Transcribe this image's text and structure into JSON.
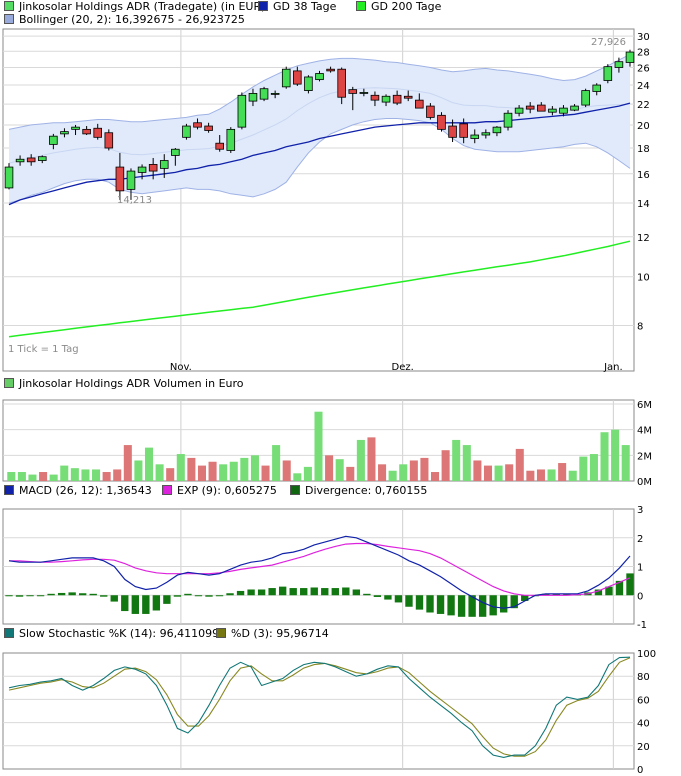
{
  "legend_main": [
    {
      "text": "Jinkosolar Holdings ADR (Tradegate) (in EUR)",
      "color": "#55dd66"
    },
    {
      "text": "GD 38 Tage",
      "color": "#1122aa"
    },
    {
      "text": "GD 200 Tage",
      "color": "#22ee22"
    },
    {
      "text": "Bollinger (20, 2): 16,392675 - 26,923725",
      "color": "#99aadd"
    }
  ],
  "legend_volume": {
    "text": "Jinkosolar Holdings ADR Volumen in Euro",
    "color": "#66cc66"
  },
  "legend_macd": [
    {
      "text": "MACD (26, 12): 1,36543",
      "color": "#1122aa"
    },
    {
      "text": "EXP (9): 0,605275",
      "color": "#dd22dd"
    },
    {
      "text": "Divergence: 0,760155",
      "color": "#116611"
    }
  ],
  "legend_stoch": [
    {
      "text": "Slow Stochastic %K (14): 96,411099",
      "color": "#117777"
    },
    {
      "text": "%D (3): 95,96714",
      "color": "#777711"
    }
  ],
  "tick_note": "1 Tick = 1 Tag",
  "annotations": {
    "low": "14,213",
    "high": "27,926"
  },
  "colors": {
    "up": "#44dd55",
    "down": "#dd4444",
    "boll_fill": "#e0eafa",
    "boll_line": "#9fb2e6",
    "gd38": "#1122aa",
    "gd200": "#22ee22",
    "macd": "#1122aa",
    "signal": "#dd22dd",
    "hist": "#117711",
    "stoch_k": "#117777",
    "stoch_d": "#888822",
    "vol_up": "#77dd77",
    "vol_down": "#dd7777"
  },
  "chart_data": [
    {
      "type": "candlestick",
      "title": "Jinkosolar Holdings ADR (Tradegate) (in EUR)",
      "y_scale": "log",
      "ylim": [
        6.5,
        31
      ],
      "y_ticks": [
        8,
        10,
        12,
        14,
        16,
        18,
        20,
        22,
        24,
        26,
        28,
        30
      ],
      "x_tick_labels": [
        {
          "label": "Nov.",
          "index": 16
        },
        {
          "label": "Dez.",
          "index": 36
        },
        {
          "label": "Jan.",
          "index": 55
        }
      ],
      "ohlc": [
        [
          15.0,
          16.8,
          14.9,
          16.5
        ],
        [
          16.9,
          17.4,
          16.6,
          17.1
        ],
        [
          17.2,
          17.5,
          16.6,
          16.9
        ],
        [
          17.0,
          17.4,
          16.8,
          17.3
        ],
        [
          18.3,
          19.2,
          17.9,
          19.0
        ],
        [
          19.2,
          19.7,
          18.9,
          19.4
        ],
        [
          19.6,
          20.0,
          19.1,
          19.8
        ],
        [
          19.6,
          19.9,
          19.1,
          19.2
        ],
        [
          19.7,
          20.1,
          18.7,
          18.9
        ],
        [
          19.3,
          19.6,
          17.8,
          18.0
        ],
        [
          16.5,
          17.6,
          14.2,
          14.8
        ],
        [
          14.9,
          16.4,
          14.2,
          16.2
        ],
        [
          16.1,
          16.7,
          15.6,
          16.5
        ],
        [
          16.7,
          17.2,
          15.6,
          16.2
        ],
        [
          16.4,
          17.5,
          15.7,
          17.0
        ],
        [
          17.4,
          18.0,
          16.6,
          17.9
        ],
        [
          18.9,
          20.1,
          18.7,
          19.9
        ],
        [
          20.2,
          20.6,
          19.6,
          19.8
        ],
        [
          19.9,
          20.2,
          19.3,
          19.5
        ],
        [
          18.4,
          19.1,
          17.7,
          17.9
        ],
        [
          17.8,
          19.8,
          17.6,
          19.6
        ],
        [
          19.8,
          23.2,
          19.6,
          22.9
        ],
        [
          22.3,
          23.6,
          21.8,
          23.1
        ],
        [
          22.5,
          23.8,
          22.3,
          23.6
        ],
        [
          23.1,
          23.4,
          22.6,
          23.1
        ],
        [
          23.8,
          26.1,
          23.6,
          25.8
        ],
        [
          25.6,
          26.1,
          23.9,
          24.1
        ],
        [
          23.4,
          25.1,
          23.1,
          24.9
        ],
        [
          24.6,
          25.6,
          24.4,
          25.3
        ],
        [
          25.8,
          26.1,
          25.4,
          25.6
        ],
        [
          25.8,
          26.0,
          22.0,
          22.7
        ],
        [
          23.5,
          23.8,
          21.4,
          23.1
        ],
        [
          23.2,
          23.6,
          22.8,
          23.2
        ],
        [
          22.9,
          23.3,
          21.8,
          22.4
        ],
        [
          22.2,
          23.0,
          21.8,
          22.8
        ],
        [
          22.9,
          23.4,
          21.9,
          22.1
        ],
        [
          22.8,
          23.4,
          22.3,
          22.6
        ],
        [
          22.4,
          23.1,
          22.0,
          21.6
        ],
        [
          21.8,
          22.1,
          20.5,
          20.7
        ],
        [
          20.9,
          21.2,
          19.4,
          19.6
        ],
        [
          19.9,
          20.5,
          18.5,
          18.9
        ],
        [
          20.1,
          20.6,
          18.4,
          18.9
        ],
        [
          18.8,
          19.6,
          18.4,
          19.1
        ],
        [
          19.1,
          19.6,
          18.8,
          19.3
        ],
        [
          19.3,
          19.9,
          19.0,
          19.8
        ],
        [
          19.8,
          21.4,
          19.5,
          21.1
        ],
        [
          21.1,
          21.9,
          20.8,
          21.6
        ],
        [
          21.8,
          22.2,
          21.1,
          21.5
        ],
        [
          21.9,
          22.2,
          21.3,
          21.3
        ],
        [
          21.2,
          21.8,
          20.9,
          21.5
        ],
        [
          21.1,
          21.9,
          20.8,
          21.6
        ],
        [
          21.4,
          22.0,
          21.3,
          21.8
        ],
        [
          21.9,
          23.6,
          21.7,
          23.4
        ],
        [
          23.3,
          24.2,
          22.9,
          24.0
        ],
        [
          24.5,
          26.4,
          24.2,
          26.1
        ],
        [
          26.0,
          27.2,
          25.4,
          26.7
        ],
        [
          26.6,
          28.2,
          26.1,
          27.9
        ]
      ],
      "gd38": [
        13.9,
        14.2,
        14.4,
        14.6,
        14.8,
        15.0,
        15.2,
        15.4,
        15.5,
        15.6,
        15.6,
        15.7,
        15.8,
        15.9,
        16.0,
        16.1,
        16.3,
        16.4,
        16.6,
        16.7,
        16.9,
        17.1,
        17.4,
        17.6,
        17.8,
        18.1,
        18.3,
        18.5,
        18.8,
        19.0,
        19.2,
        19.4,
        19.6,
        19.8,
        19.9,
        20.0,
        20.1,
        20.2,
        20.2,
        20.2,
        20.2,
        20.2,
        20.2,
        20.3,
        20.3,
        20.4,
        20.5,
        20.6,
        20.7,
        20.8,
        20.9,
        21.0,
        21.2,
        21.4,
        21.6,
        21.8,
        22.1
      ],
      "gd200": [
        7.6,
        7.65,
        7.7,
        7.75,
        7.8,
        7.85,
        7.9,
        7.95,
        8.0,
        8.05,
        8.1,
        8.15,
        8.2,
        8.25,
        8.3,
        8.35,
        8.4,
        8.45,
        8.5,
        8.55,
        8.6,
        8.65,
        8.7,
        8.78,
        8.86,
        8.94,
        9.02,
        9.1,
        9.18,
        9.26,
        9.34,
        9.42,
        9.5,
        9.58,
        9.66,
        9.74,
        9.82,
        9.9,
        9.98,
        10.06,
        10.14,
        10.22,
        10.3,
        10.38,
        10.46,
        10.54,
        10.62,
        10.7,
        10.8,
        10.9,
        11.0,
        11.12,
        11.24,
        11.36,
        11.48,
        11.62,
        11.76
      ],
      "boll_upper": [
        19.6,
        19.8,
        20.0,
        20.1,
        20.2,
        20.2,
        20.3,
        20.4,
        20.5,
        20.5,
        20.4,
        20.3,
        20.3,
        20.4,
        20.5,
        20.6,
        20.7,
        20.9,
        21.0,
        21.5,
        22.2,
        23.0,
        23.8,
        24.5,
        25.1,
        25.7,
        26.2,
        26.5,
        26.8,
        27.0,
        27.1,
        27.1,
        27.0,
        26.9,
        26.7,
        26.6,
        26.4,
        26.2,
        26.0,
        25.7,
        25.5,
        25.6,
        25.8,
        25.9,
        25.7,
        25.6,
        25.4,
        25.2,
        25.0,
        24.7,
        24.5,
        24.6,
        25.0,
        25.6,
        26.2,
        26.9,
        27.6
      ],
      "boll_lower": [
        14.0,
        14.2,
        14.5,
        14.7,
        15.0,
        15.3,
        15.5,
        15.6,
        15.6,
        15.4,
        14.9,
        14.7,
        14.6,
        14.7,
        14.8,
        14.9,
        15.0,
        14.9,
        14.9,
        14.8,
        14.6,
        14.5,
        14.4,
        14.6,
        14.9,
        15.4,
        16.5,
        17.6,
        18.5,
        19.2,
        19.6,
        20.0,
        20.3,
        20.5,
        20.6,
        20.6,
        20.5,
        20.4,
        20.2,
        19.6,
        18.8,
        18.2,
        17.9,
        17.8,
        17.7,
        17.7,
        17.7,
        17.8,
        17.9,
        18.0,
        18.1,
        18.3,
        18.4,
        18.1,
        17.6,
        17.0,
        16.4
      ],
      "boll_mid": [
        16.8,
        17.0,
        17.2,
        17.4,
        17.6,
        17.75,
        17.9,
        18.0,
        18.05,
        17.95,
        17.65,
        17.5,
        17.45,
        17.55,
        17.65,
        17.75,
        17.85,
        17.9,
        17.95,
        18.15,
        18.4,
        18.75,
        19.1,
        19.55,
        20.0,
        20.55,
        21.35,
        22.05,
        22.65,
        23.1,
        23.35,
        23.55,
        23.65,
        23.7,
        23.65,
        23.6,
        23.45,
        23.3,
        23.1,
        22.65,
        22.15,
        21.9,
        21.85,
        21.85,
        21.7,
        21.65,
        21.55,
        21.5,
        21.45,
        21.35,
        21.3,
        21.45,
        21.7,
        21.85,
        21.9,
        21.95,
        22.0
      ]
    },
    {
      "type": "bar",
      "title": "Jinkosolar Holdings ADR Volumen in Euro",
      "ylim": [
        0,
        6
      ],
      "y_ticks": [
        "0M",
        "2M",
        "4M",
        "6M"
      ],
      "values": [
        0.7,
        0.7,
        0.5,
        0.7,
        0.5,
        1.2,
        1.0,
        0.9,
        0.9,
        0.7,
        0.9,
        2.8,
        1.6,
        2.6,
        1.3,
        1.0,
        2.1,
        1.8,
        1.2,
        1.5,
        1.3,
        1.5,
        1.8,
        2.0,
        1.2,
        2.8,
        1.6,
        0.6,
        1.1,
        5.4,
        2.0,
        1.7,
        1.1,
        3.2,
        3.4,
        1.3,
        0.8,
        1.3,
        1.6,
        1.8,
        0.7,
        2.4,
        3.2,
        2.8,
        1.6,
        1.2,
        1.2,
        1.3,
        2.5,
        0.8,
        0.9,
        0.9,
        1.4,
        0.8,
        1.9,
        2.1,
        3.8,
        4.0,
        2.8
      ],
      "up": [
        1,
        1,
        1,
        0,
        1,
        1,
        1,
        1,
        1,
        0,
        0,
        0,
        1,
        1,
        1,
        0,
        1,
        0,
        0,
        0,
        1,
        1,
        1,
        1,
        0,
        1,
        0,
        1,
        1,
        1,
        0,
        1,
        0,
        1,
        0,
        0,
        1,
        1,
        0,
        0,
        0,
        0,
        1,
        1,
        0,
        0,
        1,
        0,
        0,
        0,
        0,
        1,
        0,
        1,
        1,
        1,
        1,
        1,
        1
      ]
    },
    {
      "type": "line",
      "title": "MACD (26, 12)",
      "ylim": [
        -1,
        3
      ],
      "y_ticks": [
        -1,
        0,
        1,
        2,
        3
      ],
      "series": [
        {
          "name": "MACD (26, 12)",
          "values": [
            1.2,
            1.15,
            1.15,
            1.15,
            1.2,
            1.25,
            1.3,
            1.3,
            1.3,
            1.2,
            1.0,
            0.55,
            0.3,
            0.2,
            0.25,
            0.45,
            0.7,
            0.8,
            0.75,
            0.7,
            0.75,
            0.9,
            1.05,
            1.15,
            1.2,
            1.3,
            1.45,
            1.5,
            1.6,
            1.75,
            1.85,
            1.95,
            2.05,
            2.0,
            1.85,
            1.7,
            1.55,
            1.4,
            1.2,
            1.05,
            0.85,
            0.65,
            0.4,
            0.15,
            -0.05,
            -0.25,
            -0.4,
            -0.45,
            -0.4,
            -0.2,
            0.0,
            0.05,
            0.05,
            0.05,
            0.05,
            0.15,
            0.35,
            0.6,
            0.95,
            1.36543
          ]
        },
        {
          "name": "EXP (9)",
          "values": [
            1.2,
            1.2,
            1.17,
            1.15,
            1.15,
            1.17,
            1.2,
            1.23,
            1.25,
            1.25,
            1.22,
            1.1,
            0.95,
            0.85,
            0.78,
            0.75,
            0.75,
            0.75,
            0.75,
            0.75,
            0.78,
            0.83,
            0.9,
            0.95,
            1.0,
            1.05,
            1.15,
            1.25,
            1.35,
            1.48,
            1.6,
            1.7,
            1.78,
            1.8,
            1.8,
            1.76,
            1.7,
            1.65,
            1.6,
            1.55,
            1.45,
            1.3,
            1.1,
            0.9,
            0.7,
            0.5,
            0.3,
            0.15,
            0.05,
            0.0,
            0.0,
            0.0,
            0.0,
            0.0,
            0.02,
            0.05,
            0.15,
            0.3,
            0.45,
            0.605275
          ]
        },
        {
          "name": "Divergence",
          "values": [
            0.0,
            -0.05,
            -0.02,
            0.0,
            0.05,
            0.08,
            0.1,
            0.07,
            0.05,
            -0.05,
            -0.22,
            -0.55,
            -0.65,
            -0.65,
            -0.53,
            -0.3,
            -0.05,
            0.05,
            0.0,
            -0.05,
            -0.03,
            0.07,
            0.15,
            0.2,
            0.2,
            0.25,
            0.3,
            0.25,
            0.25,
            0.27,
            0.25,
            0.25,
            0.27,
            0.2,
            0.05,
            -0.06,
            -0.15,
            -0.25,
            -0.4,
            -0.5,
            -0.6,
            -0.65,
            -0.7,
            -0.75,
            -0.75,
            -0.75,
            -0.7,
            -0.6,
            -0.45,
            -0.2,
            0.0,
            0.05,
            0.05,
            0.05,
            0.03,
            0.1,
            0.2,
            0.3,
            0.5,
            0.760155
          ]
        }
      ]
    },
    {
      "type": "line",
      "title": "Slow Stochastic %K (14)",
      "ylim": [
        0,
        100
      ],
      "y_ticks": [
        0,
        20,
        40,
        60,
        80,
        100
      ],
      "series": [
        {
          "name": "Slow Stochastic %K (14)",
          "values": [
            70,
            72,
            73,
            75,
            76,
            78,
            72,
            68,
            72,
            78,
            85,
            88,
            86,
            82,
            72,
            55,
            35,
            31,
            40,
            55,
            72,
            87,
            92,
            88,
            72,
            75,
            78,
            85,
            90,
            92,
            91,
            88,
            84,
            80,
            82,
            86,
            89,
            88,
            78,
            70,
            62,
            55,
            48,
            40,
            33,
            20,
            12,
            10,
            12,
            12,
            20,
            35,
            55,
            62,
            60,
            62,
            72,
            90,
            96,
            96.411099
          ]
        },
        {
          "name": "%D (3)",
          "values": [
            68,
            70,
            72,
            74,
            75,
            77,
            75,
            71,
            70,
            74,
            80,
            86,
            87,
            84,
            77,
            64,
            47,
            37,
            37,
            46,
            60,
            76,
            87,
            89,
            82,
            76,
            76,
            81,
            87,
            90,
            91,
            89,
            86,
            83,
            82,
            84,
            87,
            88,
            83,
            75,
            67,
            60,
            53,
            46,
            39,
            28,
            18,
            13,
            11,
            11,
            15,
            25,
            42,
            55,
            59,
            61,
            67,
            80,
            92,
            95.96714
          ]
        }
      ]
    }
  ]
}
